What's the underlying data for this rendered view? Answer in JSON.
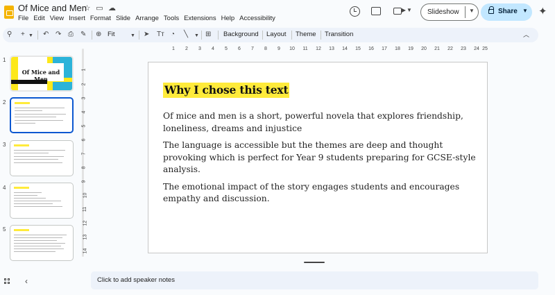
{
  "app": {
    "title": "Of Mice and Men",
    "menu": [
      "File",
      "Edit",
      "View",
      "Insert",
      "Format",
      "Slide",
      "Arrange",
      "Tools",
      "Extensions",
      "Help",
      "Accessibility"
    ],
    "slideshow_label": "Slideshow",
    "share_label": "Share",
    "accent_color": "#c2e7ff"
  },
  "toolbar": {
    "zoom_label": "Fit",
    "background_label": "Background",
    "layout_label": "Layout",
    "theme_label": "Theme",
    "transition_label": "Transition"
  },
  "ruler": {
    "top_labels": [
      "1",
      "2",
      "3",
      "4",
      "5",
      "6",
      "7",
      "8",
      "9",
      "10",
      "11",
      "12",
      "13",
      "14",
      "15",
      "16",
      "17",
      "18",
      "19",
      "20",
      "21",
      "22",
      "23",
      "24",
      "25"
    ],
    "left_labels": [
      "1",
      "2",
      "3",
      "4",
      "5",
      "6",
      "7",
      "8",
      "9",
      "10",
      "11",
      "12",
      "13",
      "14"
    ]
  },
  "filmstrip": {
    "slides": [
      {
        "number": "1",
        "title": "Of Mice and Men"
      },
      {
        "number": "2"
      },
      {
        "number": "3"
      },
      {
        "number": "4"
      },
      {
        "number": "5"
      }
    ]
  },
  "slide": {
    "title": "Why I chose this text",
    "paragraphs": [
      "Of mice and men is a short, powerful novela that explores friendship, loneliness, dreams and injustice",
      "The language is accessible but the themes are deep and thought provoking which is perfect for Year 9 students preparing for GCSE-style analysis.",
      "The emotional impact of the story engages students and encourages empathy and discussion."
    ],
    "highlight_color": "#ffeb3b"
  },
  "notes": {
    "placeholder": "Click to add speaker notes"
  }
}
